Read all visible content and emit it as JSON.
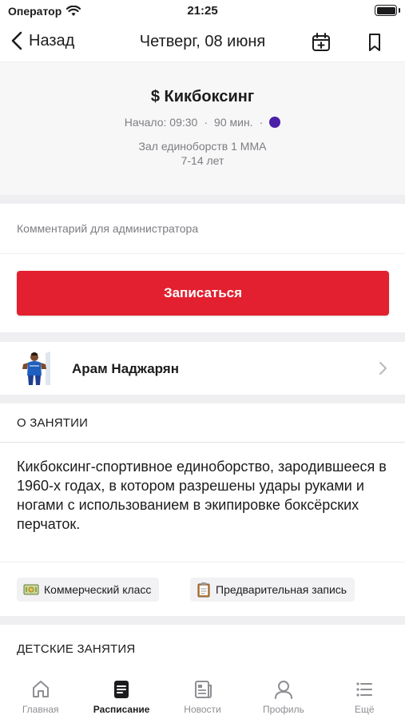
{
  "status_bar": {
    "carrier": "Оператор",
    "time": "21:25"
  },
  "nav": {
    "back_label": "Назад",
    "title": "Четверг, 08 июня",
    "icons": [
      "add-to-calendar-icon",
      "bookmark-icon"
    ]
  },
  "class_info": {
    "title": "$ Кикбоксинг",
    "start": "Начало: 09:30",
    "duration": "90 мин.",
    "separator": "·",
    "color": "#4b1fa8",
    "hall": "Зал единоборств 1 ММА",
    "age": "7-14 лет"
  },
  "comment": {
    "placeholder": "Комментарий для администратора"
  },
  "enroll": {
    "label": "Записаться",
    "color": "#e3202f"
  },
  "trainer": {
    "name": "Арам Наджарян"
  },
  "about": {
    "title": "О ЗАНЯТИИ",
    "text": "Кикбоксинг-спортивное единоборство, зародившееся в 1960-х годах, в котором разрешены удары руками и ногами с использованием в экипировке боксёрских перчаток."
  },
  "tags": [
    {
      "icon": "money-icon",
      "label": "Коммерческий класс"
    },
    {
      "icon": "clipboard-icon",
      "label": "Предварительная запись"
    }
  ],
  "kids": {
    "title": "ДЕТСКИЕ ЗАНЯТИЯ"
  },
  "tab_bar": {
    "items": [
      {
        "label": "Главная",
        "icon": "home-icon",
        "active": false
      },
      {
        "label": "Расписание",
        "icon": "schedule-icon",
        "active": true
      },
      {
        "label": "Новости",
        "icon": "news-icon",
        "active": false
      },
      {
        "label": "Профиль",
        "icon": "profile-icon",
        "active": false
      },
      {
        "label": "Ещё",
        "icon": "more-icon",
        "active": false
      }
    ]
  }
}
